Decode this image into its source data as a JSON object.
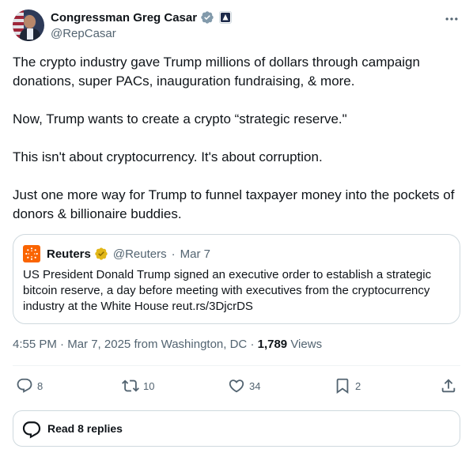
{
  "author": {
    "display_name": "Congressman Greg Casar",
    "handle": "@RepCasar",
    "avatar": "avatar",
    "verified_badge": "gray-verified-badge-icon",
    "affiliation_badge": "house-badge-icon"
  },
  "more_icon": "more-horizontal-icon",
  "tweet": {
    "text": "The crypto industry gave Trump millions of dollars through campaign donations, super PACs, inauguration fundraising, & more.\n\nNow, Trump wants to create a crypto “strategic reserve.\"\n\nThis isn't about cryptocurrency. It's about corruption.\n\nJust one more way for Trump to funnel taxpayer money into the pockets of donors & billionaire buddies."
  },
  "quote": {
    "name": "Reuters",
    "handle": "@Reuters",
    "separator": "·",
    "date": "Mar 7",
    "logo": "reuters-logo-icon",
    "verified_badge": "gold-verified-badge-icon",
    "text": "US President Donald Trump signed an executive order to establish a strategic bitcoin reserve, a day before meeting with executives from the cryptocurrency industry at the White House reut.rs/3DjcrDS"
  },
  "meta": {
    "time": "4:55 PM",
    "date": "Mar 7, 2025",
    "location": "from Washington, DC",
    "separator": "·",
    "views_count": "1,789",
    "views_label": "Views"
  },
  "actions": {
    "replies": "8",
    "reposts": "10",
    "likes": "34",
    "bookmarks": "2"
  },
  "read_replies": {
    "label": "Read 8 replies"
  },
  "colors": {
    "text": "#0f1419",
    "secondary": "#536471",
    "border": "#cfd9de",
    "reuters_orange": "#fa6400",
    "gold_badge": "#e2b719",
    "gray_badge": "#829aab"
  }
}
